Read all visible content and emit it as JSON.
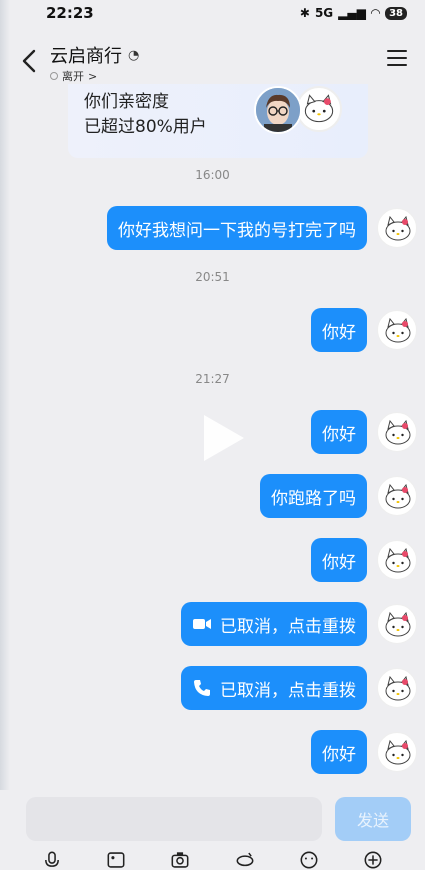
{
  "status_bar": {
    "time": "22:23",
    "network": "5G",
    "battery": "38"
  },
  "header": {
    "title": "云启商行",
    "presence": "离开",
    "presence_arrow": ">"
  },
  "intimacy_card": {
    "line1": "你们亲密度",
    "line2": "已超过80%用户"
  },
  "messages": [
    {
      "time": "16:00",
      "text": "你好我想问一下我的号打完了吗"
    },
    {
      "time": "20:51",
      "text": "你好"
    },
    {
      "time": "21:27",
      "text": "你好"
    },
    {
      "text": "你跑路了吗"
    },
    {
      "text": "你好"
    },
    {
      "text": "已取消，点击重拨",
      "icon": "video-call-icon"
    },
    {
      "text": "已取消，点击重拨",
      "icon": "phone-call-icon"
    },
    {
      "text": "你好"
    }
  ],
  "input": {
    "placeholder": "",
    "send_label": "发送"
  },
  "toolbar": [
    "microphone-icon",
    "image-icon",
    "camera-icon",
    "red-packet-icon",
    "emoji-icon",
    "plus-icon"
  ],
  "colors": {
    "bubble": "#1c8ffb",
    "send_disabled": "#a3cdf7",
    "background": "#eeeef1"
  }
}
